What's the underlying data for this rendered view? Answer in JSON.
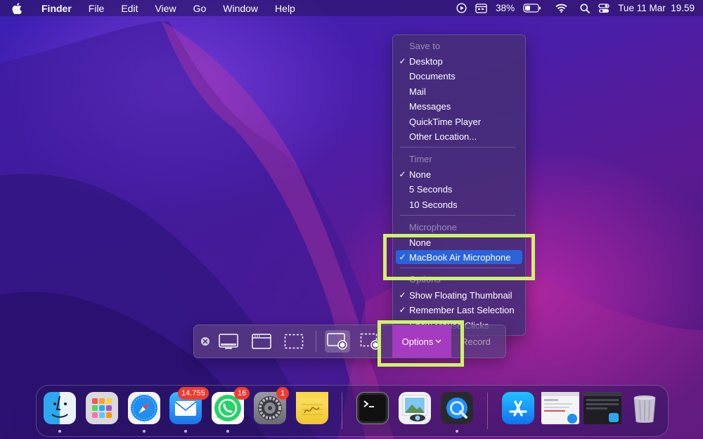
{
  "menubar": {
    "app_name": "Finder",
    "menus": [
      "File",
      "Edit",
      "View",
      "Go",
      "Window",
      "Help"
    ],
    "battery_percent": "38%",
    "datetime": "Tue 11 Mar  19.59"
  },
  "capture_menu": {
    "save_to": {
      "header": "Save to",
      "items": [
        {
          "label": "Desktop",
          "checked": true
        },
        {
          "label": "Documents",
          "checked": false
        },
        {
          "label": "Mail",
          "checked": false
        },
        {
          "label": "Messages",
          "checked": false
        },
        {
          "label": "QuickTime Player",
          "checked": false
        },
        {
          "label": "Other Location...",
          "checked": false
        }
      ]
    },
    "timer": {
      "header": "Timer",
      "items": [
        {
          "label": "None",
          "checked": true
        },
        {
          "label": "5 Seconds",
          "checked": false
        },
        {
          "label": "10 Seconds",
          "checked": false
        }
      ]
    },
    "microphone": {
      "header": "Microphone",
      "items": [
        {
          "label": "None",
          "checked": false
        },
        {
          "label": "MacBook Air Microphone",
          "checked": true,
          "selected": true
        }
      ]
    },
    "options": {
      "header": "Options",
      "items": [
        {
          "label": "Show Floating Thumbnail",
          "checked": true
        },
        {
          "label": "Remember Last Selection",
          "checked": true
        },
        {
          "label": "Show Mouse Clicks",
          "checked": false
        }
      ]
    }
  },
  "toolbar": {
    "options_label": "Options",
    "record_label": "Record"
  },
  "dock": {
    "badges": {
      "mail": "14.755",
      "whatsapp": "16",
      "system_settings": "1"
    }
  },
  "colors": {
    "highlight": "#cdf36a",
    "selected_row": "#2a63d9",
    "options_button": "#a53bc0",
    "badge": "#ef3b30"
  }
}
